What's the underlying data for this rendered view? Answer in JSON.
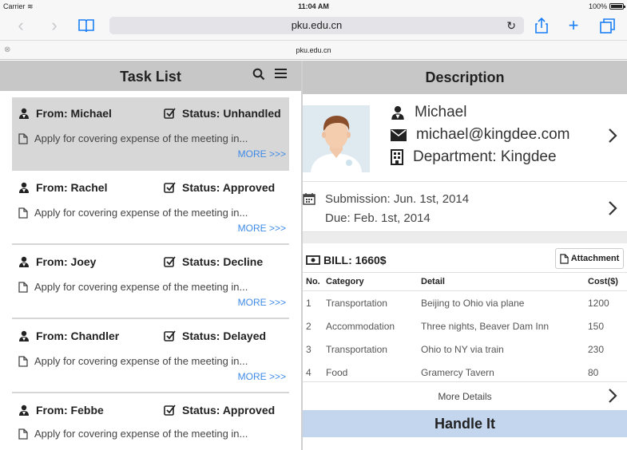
{
  "status_bar": {
    "carrier": "Carrier",
    "time": "11:04 AM",
    "battery": "100%"
  },
  "browser": {
    "url": "pku.edu.cn",
    "tab_title": "pku.edu.cn"
  },
  "task_list": {
    "title": "Task List",
    "tasks": [
      {
        "from": "From: Michael",
        "status": "Status: Unhandled",
        "desc": "Apply for covering expense of the meeting in...",
        "more": "MORE >>>",
        "selected": true
      },
      {
        "from": "From: Rachel",
        "status": "Status: Approved",
        "desc": "Apply for covering expense of the meeting in...",
        "more": "MORE >>>"
      },
      {
        "from": "From: Joey",
        "status": "Status: Decline",
        "desc": "Apply for covering expense of the meeting in...",
        "more": "MORE >>>"
      },
      {
        "from": "From: Chandler",
        "status": "Status: Delayed",
        "desc": "Apply for covering expense of the meeting in...",
        "more": "MORE >>>"
      },
      {
        "from": "From: Febbe",
        "status": "Status: Approved",
        "desc": "Apply for covering expense of the meeting in...",
        "more": ""
      }
    ]
  },
  "description": {
    "title": "Description",
    "contact": {
      "name": "Michael",
      "email": "michael@kingdee.com",
      "department": "Department: Kingdee"
    },
    "dates": {
      "submission": "Submission: Jun. 1st, 2014",
      "due": "Due: Feb. 1st, 2014"
    },
    "bill": {
      "title": "BILL: 1660$",
      "attachment_label": "Attachment",
      "columns": [
        "No.",
        "Category",
        "Detail",
        "Cost($)"
      ],
      "rows": [
        [
          "1",
          "Transportation",
          "Beijing to Ohio via plane",
          "1200"
        ],
        [
          "2",
          "Accommodation",
          "Three nights, Beaver Dam Inn",
          "150"
        ],
        [
          "3",
          "Transportation",
          "Ohio to NY via train",
          "230"
        ],
        [
          "4",
          "Food",
          "Gramercy Tavern",
          "80"
        ]
      ],
      "more_details": "More Details"
    },
    "handle_label": "Handle It"
  },
  "colors": {
    "accent": "#1a7ff5",
    "link": "#3f8be8",
    "header_gray": "#c7c7c7",
    "handle_blue": "#c3d6ed"
  }
}
